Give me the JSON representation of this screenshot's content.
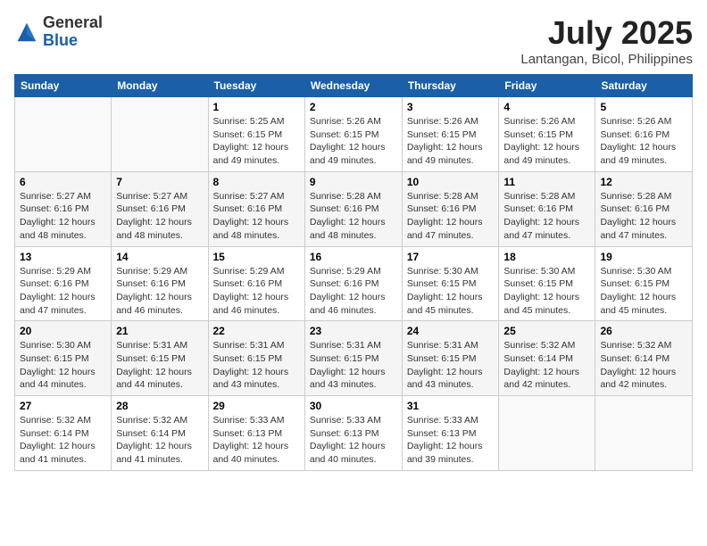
{
  "logo": {
    "general": "General",
    "blue": "Blue"
  },
  "title": "July 2025",
  "location": "Lantangan, Bicol, Philippines",
  "days_of_week": [
    "Sunday",
    "Monday",
    "Tuesday",
    "Wednesday",
    "Thursday",
    "Friday",
    "Saturday"
  ],
  "weeks": [
    [
      {
        "day": "",
        "info": ""
      },
      {
        "day": "",
        "info": ""
      },
      {
        "day": "1",
        "info": "Sunrise: 5:25 AM\nSunset: 6:15 PM\nDaylight: 12 hours and 49 minutes."
      },
      {
        "day": "2",
        "info": "Sunrise: 5:26 AM\nSunset: 6:15 PM\nDaylight: 12 hours and 49 minutes."
      },
      {
        "day": "3",
        "info": "Sunrise: 5:26 AM\nSunset: 6:15 PM\nDaylight: 12 hours and 49 minutes."
      },
      {
        "day": "4",
        "info": "Sunrise: 5:26 AM\nSunset: 6:15 PM\nDaylight: 12 hours and 49 minutes."
      },
      {
        "day": "5",
        "info": "Sunrise: 5:26 AM\nSunset: 6:16 PM\nDaylight: 12 hours and 49 minutes."
      }
    ],
    [
      {
        "day": "6",
        "info": "Sunrise: 5:27 AM\nSunset: 6:16 PM\nDaylight: 12 hours and 48 minutes."
      },
      {
        "day": "7",
        "info": "Sunrise: 5:27 AM\nSunset: 6:16 PM\nDaylight: 12 hours and 48 minutes."
      },
      {
        "day": "8",
        "info": "Sunrise: 5:27 AM\nSunset: 6:16 PM\nDaylight: 12 hours and 48 minutes."
      },
      {
        "day": "9",
        "info": "Sunrise: 5:28 AM\nSunset: 6:16 PM\nDaylight: 12 hours and 48 minutes."
      },
      {
        "day": "10",
        "info": "Sunrise: 5:28 AM\nSunset: 6:16 PM\nDaylight: 12 hours and 47 minutes."
      },
      {
        "day": "11",
        "info": "Sunrise: 5:28 AM\nSunset: 6:16 PM\nDaylight: 12 hours and 47 minutes."
      },
      {
        "day": "12",
        "info": "Sunrise: 5:28 AM\nSunset: 6:16 PM\nDaylight: 12 hours and 47 minutes."
      }
    ],
    [
      {
        "day": "13",
        "info": "Sunrise: 5:29 AM\nSunset: 6:16 PM\nDaylight: 12 hours and 47 minutes."
      },
      {
        "day": "14",
        "info": "Sunrise: 5:29 AM\nSunset: 6:16 PM\nDaylight: 12 hours and 46 minutes."
      },
      {
        "day": "15",
        "info": "Sunrise: 5:29 AM\nSunset: 6:16 PM\nDaylight: 12 hours and 46 minutes."
      },
      {
        "day": "16",
        "info": "Sunrise: 5:29 AM\nSunset: 6:16 PM\nDaylight: 12 hours and 46 minutes."
      },
      {
        "day": "17",
        "info": "Sunrise: 5:30 AM\nSunset: 6:15 PM\nDaylight: 12 hours and 45 minutes."
      },
      {
        "day": "18",
        "info": "Sunrise: 5:30 AM\nSunset: 6:15 PM\nDaylight: 12 hours and 45 minutes."
      },
      {
        "day": "19",
        "info": "Sunrise: 5:30 AM\nSunset: 6:15 PM\nDaylight: 12 hours and 45 minutes."
      }
    ],
    [
      {
        "day": "20",
        "info": "Sunrise: 5:30 AM\nSunset: 6:15 PM\nDaylight: 12 hours and 44 minutes."
      },
      {
        "day": "21",
        "info": "Sunrise: 5:31 AM\nSunset: 6:15 PM\nDaylight: 12 hours and 44 minutes."
      },
      {
        "day": "22",
        "info": "Sunrise: 5:31 AM\nSunset: 6:15 PM\nDaylight: 12 hours and 43 minutes."
      },
      {
        "day": "23",
        "info": "Sunrise: 5:31 AM\nSunset: 6:15 PM\nDaylight: 12 hours and 43 minutes."
      },
      {
        "day": "24",
        "info": "Sunrise: 5:31 AM\nSunset: 6:15 PM\nDaylight: 12 hours and 43 minutes."
      },
      {
        "day": "25",
        "info": "Sunrise: 5:32 AM\nSunset: 6:14 PM\nDaylight: 12 hours and 42 minutes."
      },
      {
        "day": "26",
        "info": "Sunrise: 5:32 AM\nSunset: 6:14 PM\nDaylight: 12 hours and 42 minutes."
      }
    ],
    [
      {
        "day": "27",
        "info": "Sunrise: 5:32 AM\nSunset: 6:14 PM\nDaylight: 12 hours and 41 minutes."
      },
      {
        "day": "28",
        "info": "Sunrise: 5:32 AM\nSunset: 6:14 PM\nDaylight: 12 hours and 41 minutes."
      },
      {
        "day": "29",
        "info": "Sunrise: 5:33 AM\nSunset: 6:13 PM\nDaylight: 12 hours and 40 minutes."
      },
      {
        "day": "30",
        "info": "Sunrise: 5:33 AM\nSunset: 6:13 PM\nDaylight: 12 hours and 40 minutes."
      },
      {
        "day": "31",
        "info": "Sunrise: 5:33 AM\nSunset: 6:13 PM\nDaylight: 12 hours and 39 minutes."
      },
      {
        "day": "",
        "info": ""
      },
      {
        "day": "",
        "info": ""
      }
    ]
  ]
}
